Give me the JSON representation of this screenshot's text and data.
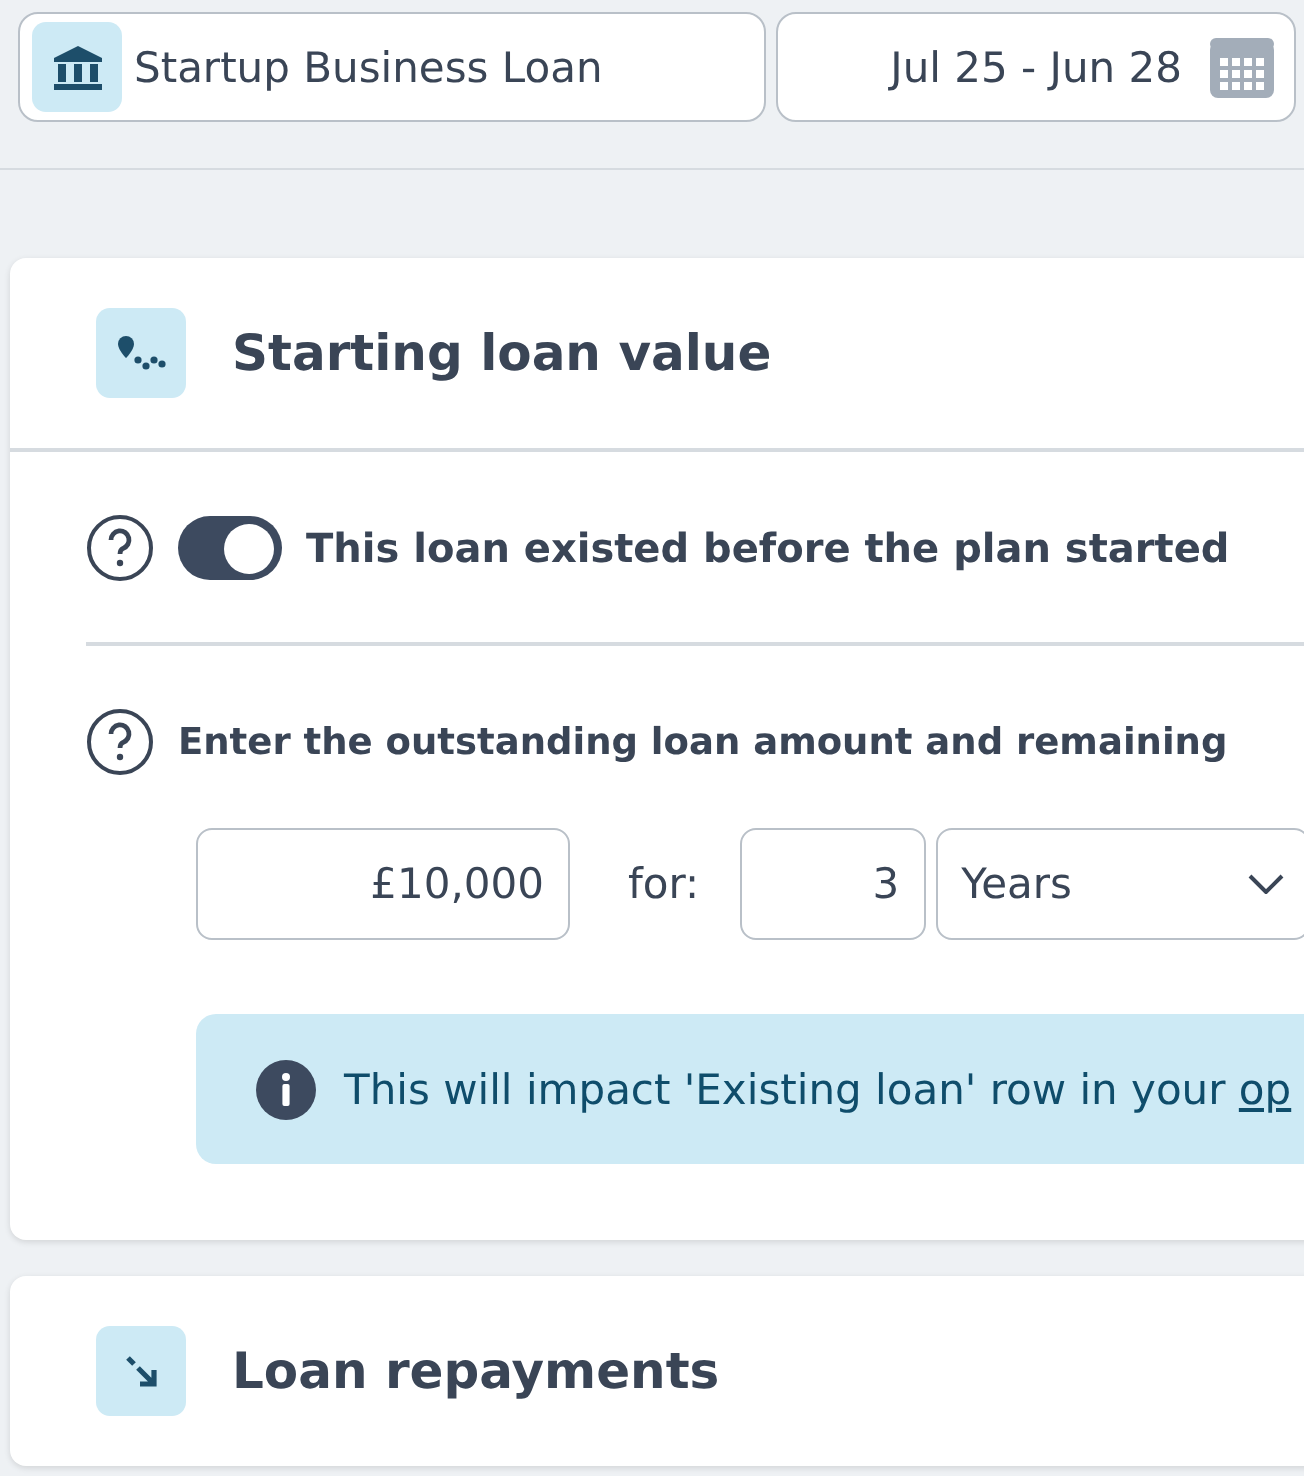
{
  "loan_select": {
    "label": "Startup Business Loan"
  },
  "date_range": {
    "value": "Jul 25 - Jun 28"
  },
  "cards": [
    {
      "title": "Starting loan value",
      "kind": "route",
      "toggle": {
        "label": "This loan existed before the plan started",
        "on": true
      },
      "question": "Enter the outstanding loan amount and remaining",
      "amount": "£10,000",
      "for_label": "for:",
      "term": "3",
      "unit": "Years",
      "info": {
        "text": "This will impact 'Existing loan' row in your ",
        "link": "op"
      }
    },
    {
      "title": "Loan repayments",
      "kind": "arrow"
    }
  ]
}
